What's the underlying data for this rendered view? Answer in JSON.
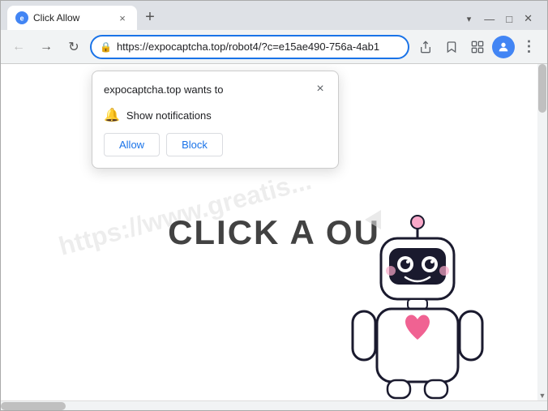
{
  "browser": {
    "tab": {
      "title": "Click Allow",
      "favicon": "e",
      "close_label": "×"
    },
    "tab_new_label": "+",
    "window_controls": {
      "minimize": "—",
      "maximize": "□",
      "close": "✕"
    },
    "address_bar": {
      "url": "https://expocaptcha.top/robot4/?c=e15ae490-756a-4ab1",
      "lock_icon": "🔒"
    },
    "nav": {
      "back": "←",
      "forward": "→",
      "reload": "↻"
    }
  },
  "popup": {
    "site": "expocaptcha.top wants to",
    "permission": "Show notifications",
    "allow_label": "Allow",
    "block_label": "Block",
    "close_label": "×"
  },
  "page": {
    "main_text": "CLICK A    OU",
    "watermark": "https://www.greatis..."
  },
  "scrollbar": {
    "up_arrow": "▲",
    "down_arrow": "▼"
  }
}
